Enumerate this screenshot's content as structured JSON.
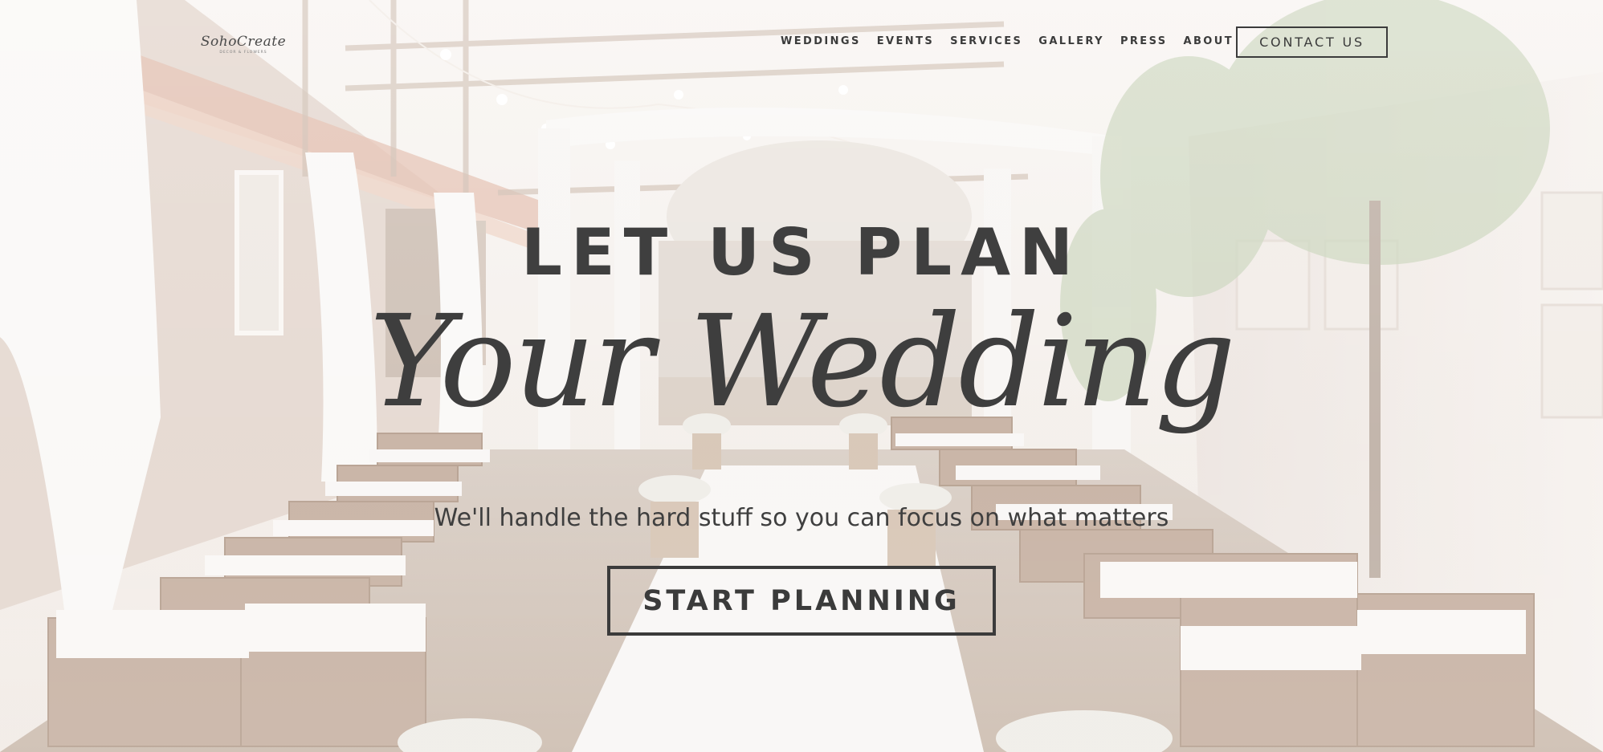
{
  "header": {
    "logo": {
      "script": "SohoCreate",
      "subtitle": "DECOR & FLOWERS"
    },
    "nav": [
      "WEDDINGS",
      "EVENTS",
      "SERVICES",
      "GALLERY",
      "PRESS",
      "ABOUT"
    ],
    "contact_label": "CONTACT US"
  },
  "hero": {
    "line1": "LET US PLAN",
    "line2": "Your Wedding",
    "subtitle": "We'll handle the hard stuff so you can focus on what matters",
    "cta_label": "START PLANNING"
  },
  "colors": {
    "text": "#3b3b3b",
    "background": "#efe9e4"
  }
}
